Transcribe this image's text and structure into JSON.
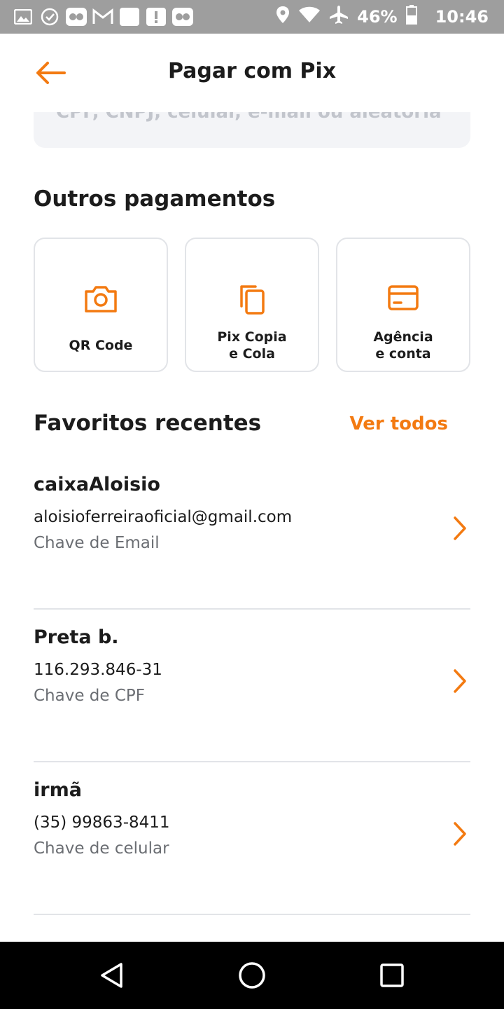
{
  "status_bar": {
    "left_icons": [
      "gallery-icon",
      "check-circle-icon",
      "infinity-icon",
      "gmail-icon",
      "square-icon",
      "alert-icon",
      "infinity-icon"
    ],
    "battery_percent": "46%",
    "time": "10:46"
  },
  "header": {
    "title": "Pagar com Pix"
  },
  "key_input": {
    "placeholder": "CPF, CNPJ, celular, e-mail ou aleatória"
  },
  "other_payments": {
    "title": "Outros pagamentos",
    "cards": [
      {
        "label": "QR Code",
        "icon": "camera-icon"
      },
      {
        "label": "Pix Copia\ne Cola",
        "icon": "copy-icon"
      },
      {
        "label": "Agência\ne conta",
        "icon": "card-icon"
      }
    ]
  },
  "favorites": {
    "title": "Favoritos recentes",
    "see_all": "Ver todos",
    "items": [
      {
        "name": "caixaAloisio",
        "key": "aloisioferreiraoficial@gmail.com",
        "type": "Chave de Email"
      },
      {
        "name": "Preta b.",
        "key": "116.293.846-31",
        "type": "Chave de CPF"
      },
      {
        "name": "irmã",
        "key": "(35) 99863-8411",
        "type": "Chave de celular"
      }
    ]
  },
  "colors": {
    "accent": "#f37a11",
    "status_bar": "#9e9e9e",
    "field_bg": "#f3f4f7",
    "border": "#e2e4e8"
  }
}
